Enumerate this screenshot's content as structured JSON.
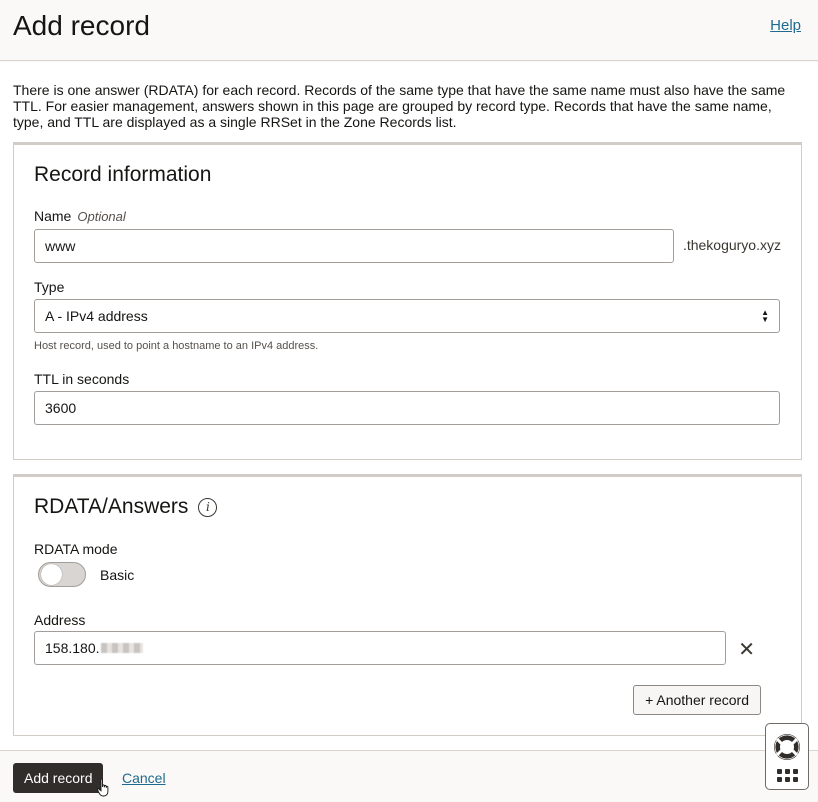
{
  "header": {
    "title": "Add record",
    "help_label": "Help"
  },
  "intro_text": "There is one answer (RDATA) for each record. Records of the same type that have the same name must also have the same TTL. For easier management, answers shown in this page are grouped by record type. Records that have the same name, type, and TTL are displayed as a single RRSet in the Zone Records list.",
  "record_info": {
    "title": "Record information",
    "name_label": "Name",
    "name_optional": "Optional",
    "name_value": "www",
    "name_suffix": ".thekoguryo.xyz",
    "type_label": "Type",
    "type_value": "A - IPv4 address",
    "type_helper": "Host record, used to point a hostname to an IPv4 address.",
    "ttl_label": "TTL in seconds",
    "ttl_value": "3600"
  },
  "rdata": {
    "title": "RDATA/Answers",
    "mode_label": "RDATA mode",
    "mode_value": "Basic",
    "address_label": "Address",
    "address_value": "158.180.",
    "another_record_label": "+ Another record"
  },
  "footer": {
    "submit_label": "Add record",
    "cancel_label": "Cancel"
  },
  "icons": {
    "info": "info-icon",
    "close": "close-icon",
    "help_widget": "lifebuoy-icon",
    "apps": "grid-icon"
  }
}
